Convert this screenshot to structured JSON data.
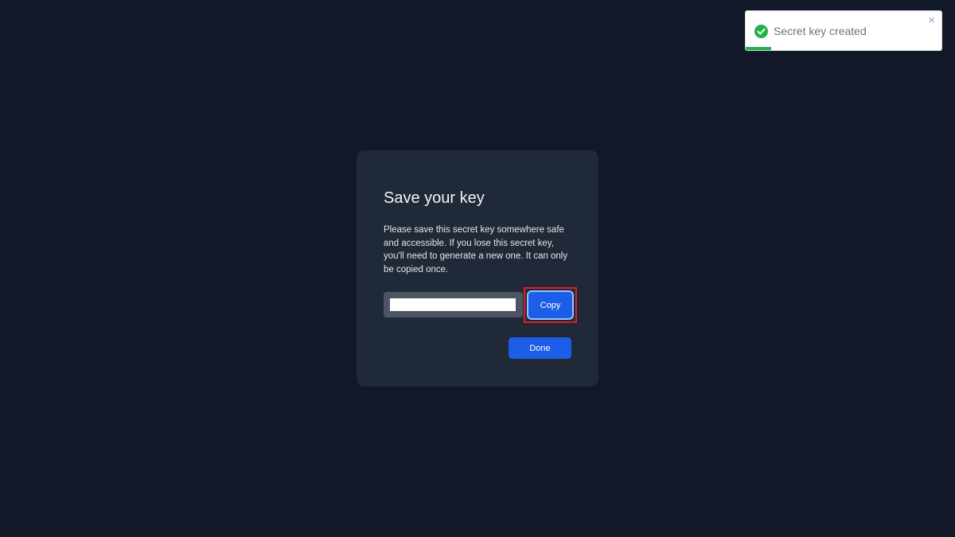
{
  "toast": {
    "message": "Secret key created",
    "close_label": "×",
    "icon": "check-circle-icon",
    "progress_fraction": 0.13,
    "colors": {
      "success": "#22b14c"
    }
  },
  "modal": {
    "title": "Save your key",
    "description": "Please save this secret key somewhere safe and accessible. If you lose this secret key, you'll need to generate a new one. It can only be copied once.",
    "key_value": "",
    "copy_label": "Copy",
    "done_label": "Done"
  },
  "colors": {
    "background": "#111827",
    "modal": "#1f2937",
    "accent": "#1d5ee8",
    "highlight": "#e11d2a"
  }
}
